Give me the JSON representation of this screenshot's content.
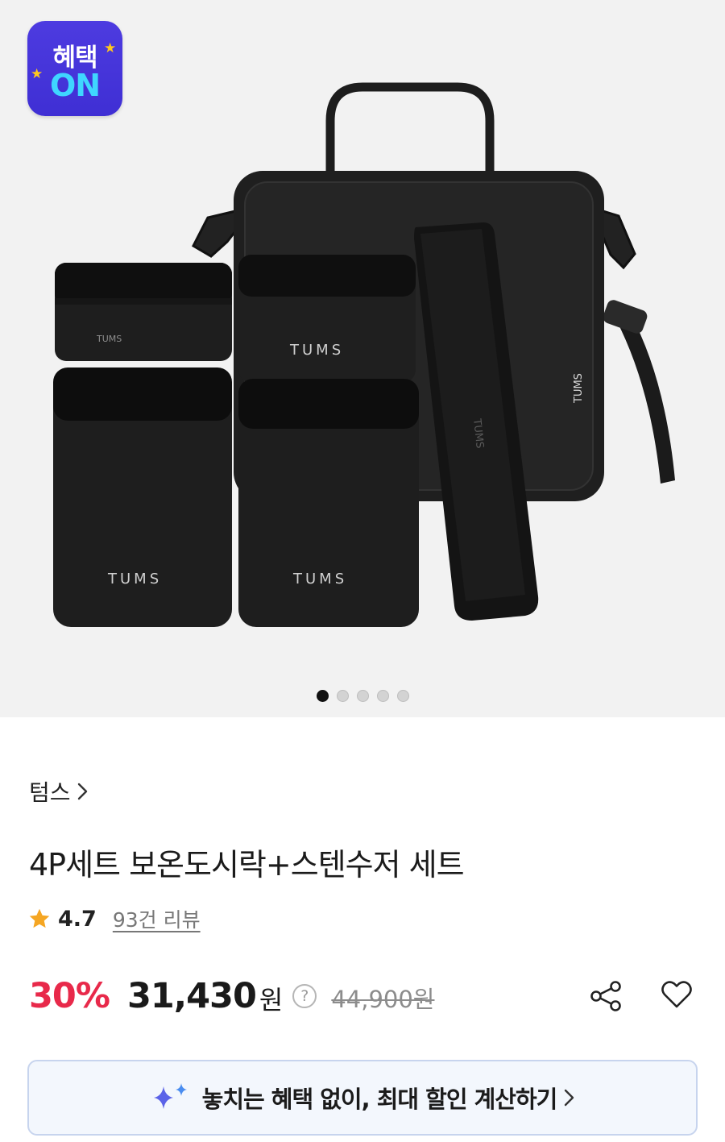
{
  "gallery": {
    "badge_line1": "혜택",
    "badge_line2": "ON",
    "product_text": [
      "TUMS",
      "TUMS",
      "TUMS",
      "TUMS",
      "TUMS"
    ],
    "slide_count": 5,
    "active_slide": 1
  },
  "product": {
    "brand": "텀스",
    "title": "4P세트 보온도시락+스텐수저 세트",
    "rating": "4.7",
    "review_count": "93건 리뷰",
    "discount": "30%",
    "price": "31,430",
    "currency": "원",
    "help": "?",
    "original_price": "44,900원"
  },
  "benefit": {
    "label": "놓치는 혜택 없이, 최대 할인 계산하기"
  },
  "icons": {
    "rating_star": "star-icon",
    "share": "share-icon",
    "like": "heart-icon",
    "benefit": "sparkle-icon",
    "chevron": "chevron-right-icon"
  },
  "colors": {
    "discount": "#e8294a",
    "badge": "#4d3be0",
    "badge_on": "#3fd6ff",
    "star": "#f5a623",
    "sparkle": "#5b63e8"
  }
}
